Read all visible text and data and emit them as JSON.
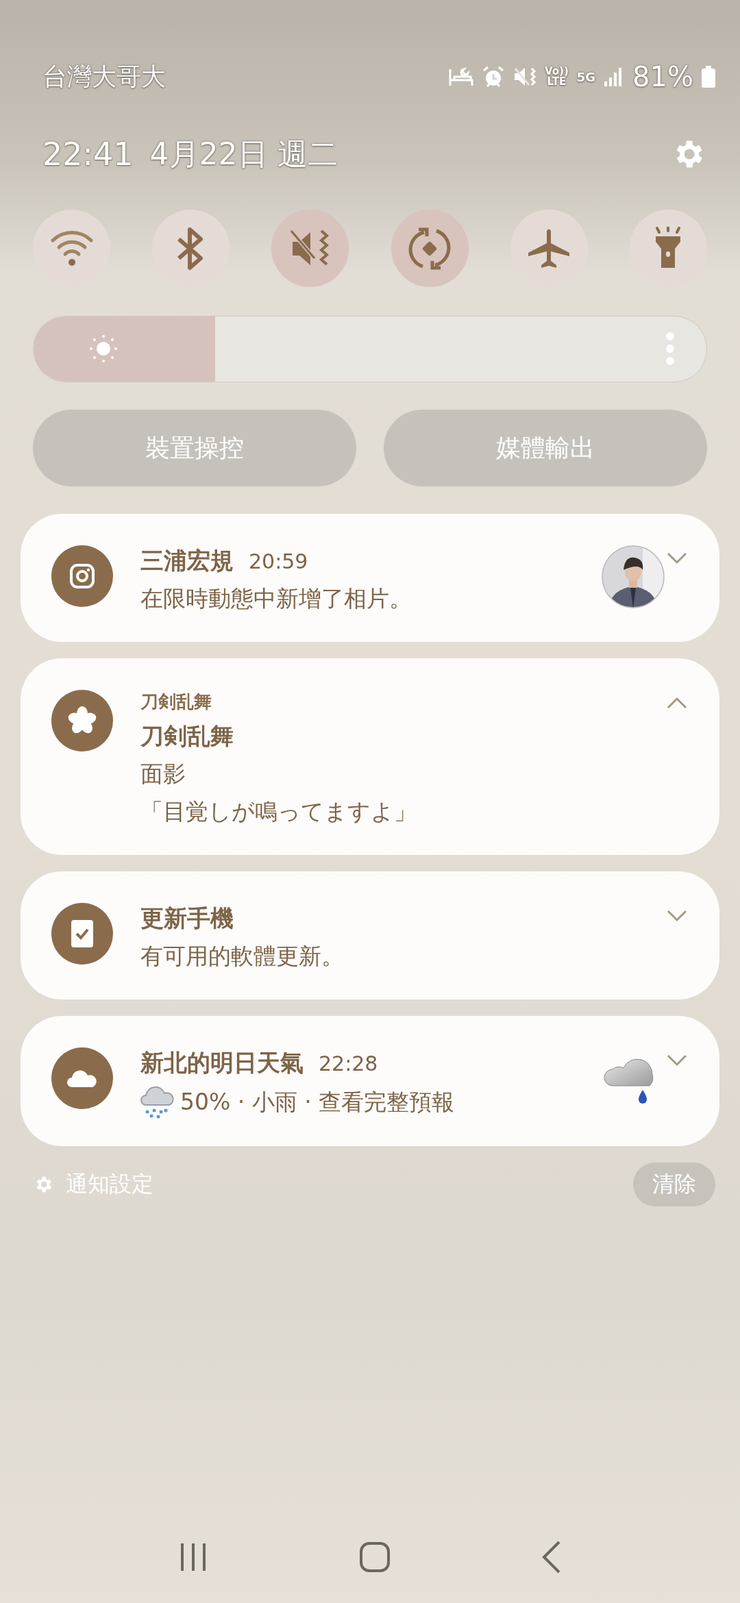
{
  "status_bar": {
    "carrier": "台灣大哥大",
    "volte_top": "Vo))",
    "volte_bottom": "LTE",
    "network": "5G",
    "battery": "81%"
  },
  "header": {
    "time": "22:41",
    "date": "4月22日 週二"
  },
  "quick_toggles": [
    {
      "kind": "wifi",
      "on": false
    },
    {
      "kind": "bluetooth",
      "on": false
    },
    {
      "kind": "mute",
      "on": true
    },
    {
      "kind": "rotate",
      "on": true
    },
    {
      "kind": "airplane",
      "on": false
    },
    {
      "kind": "flashlight",
      "on": false
    }
  ],
  "brightness": {
    "level": 0.27
  },
  "buttons": [
    {
      "label": "裝置操控"
    },
    {
      "label": "媒體輸出"
    }
  ],
  "notifications": [
    {
      "kind": "camera",
      "title": "三浦宏規",
      "time": "20:59",
      "lines": [
        {
          "kind": "plain",
          "text": "在限時動態中新增了相片。"
        }
      ],
      "thumbnail": {
        "kind": "picture"
      },
      "expanded": false
    },
    {
      "kind": "flower",
      "app_label": "刀剣乱舞",
      "title": "刀剣乱舞",
      "lines": [
        {
          "kind": "plain",
          "text": "面影"
        },
        {
          "kind": "plain",
          "text": "「目覚しが鳴ってますよ」"
        }
      ],
      "expanded": true
    },
    {
      "kind": "update",
      "title": "更新手機",
      "lines": [
        {
          "kind": "plain",
          "text": "有可用的軟體更新。"
        }
      ],
      "expanded": false
    },
    {
      "kind": "cloud",
      "title": "新北的明日天氣",
      "time": "22:28",
      "lines": [
        {
          "kind": "rain",
          "text": "50% · 小雨 · 查看完整預報"
        }
      ],
      "thumbnail": {
        "kind": "weather"
      },
      "expanded": false
    }
  ],
  "footer": {
    "settings_label": "通知設定",
    "clear_label": "清除"
  }
}
